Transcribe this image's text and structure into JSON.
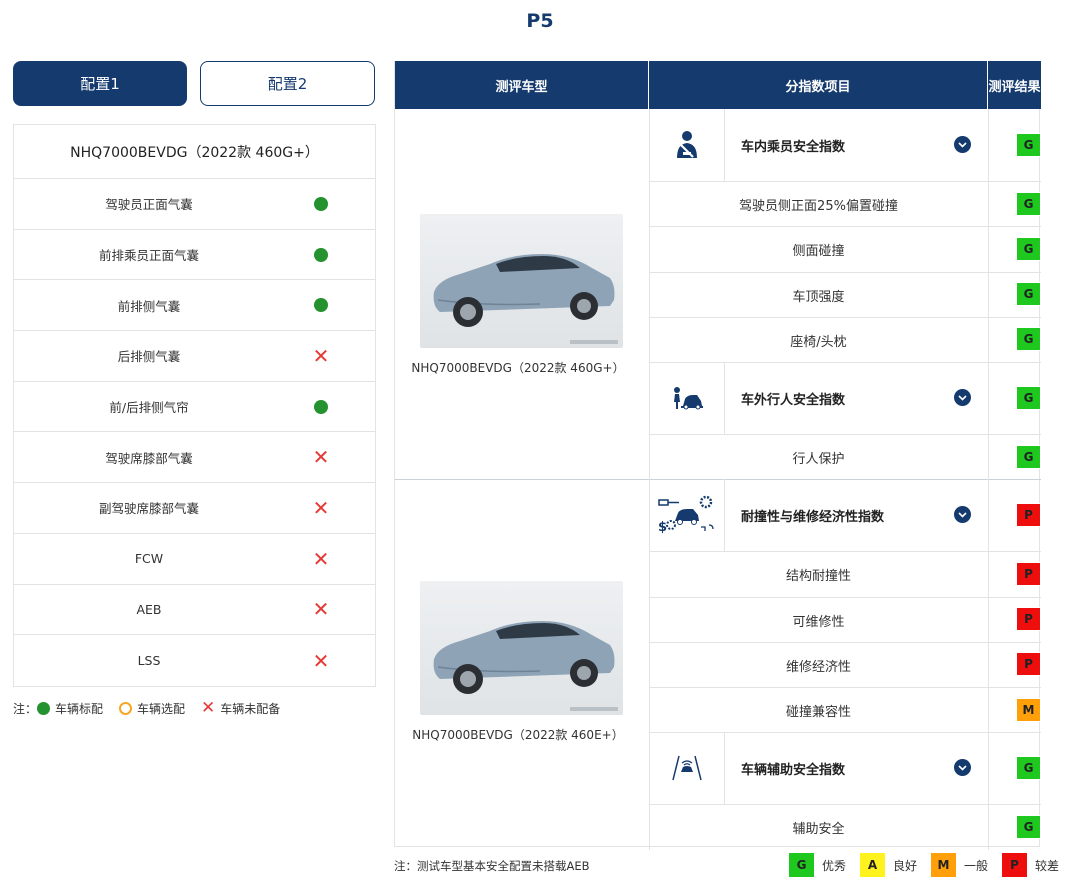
{
  "page": {
    "title": "P5"
  },
  "tabs": [
    {
      "label": "配置1",
      "active": true
    },
    {
      "label": "配置2",
      "active": false
    }
  ],
  "config": {
    "model": "NHQ7000BEVDG（2022款 460G+）",
    "rows": [
      {
        "label": "驾驶员正面气囊",
        "status": "standard"
      },
      {
        "label": "前排乘员正面气囊",
        "status": "standard"
      },
      {
        "label": "前排侧气囊",
        "status": "standard"
      },
      {
        "label": "后排侧气囊",
        "status": "not-equipped"
      },
      {
        "label": "前/后排侧气帘",
        "status": "standard"
      },
      {
        "label": "驾驶席膝部气囊",
        "status": "not-equipped"
      },
      {
        "label": "副驾驶席膝部气囊",
        "status": "not-equipped"
      },
      {
        "label": "FCW",
        "status": "not-equipped"
      },
      {
        "label": "AEB",
        "status": "not-equipped"
      },
      {
        "label": "LSS",
        "status": "not-equipped"
      }
    ]
  },
  "legend_left": {
    "prefix": "注：",
    "standard": "车辆标配",
    "optional": "车辆选配",
    "not_equipped": "车辆未配备"
  },
  "table": {
    "headers": {
      "car": "测评车型",
      "item": "分指数项目",
      "result": "测评结果"
    },
    "cars": [
      {
        "caption": "NHQ7000BEVDG（2022款 460G+）"
      },
      {
        "caption": "NHQ7000BEVDG（2022款 460E+）"
      }
    ],
    "categories": [
      {
        "title": "车内乘员安全指数",
        "icon": "seatbelt-occupant-icon",
        "rating": "G",
        "items": [
          {
            "label": "驾驶员侧正面25%偏置碰撞",
            "rating": "G"
          },
          {
            "label": "侧面碰撞",
            "rating": "G"
          },
          {
            "label": "车顶强度",
            "rating": "G"
          },
          {
            "label": "座椅/头枕",
            "rating": "G"
          }
        ]
      },
      {
        "title": "车外行人安全指数",
        "icon": "pedestrian-car-icon",
        "rating": "G",
        "items": [
          {
            "label": "行人保护",
            "rating": "G"
          }
        ]
      },
      {
        "title": "耐撞性与维修经济性指数",
        "icon": "repair-cost-icon",
        "rating": "P",
        "items": [
          {
            "label": "结构耐撞性",
            "rating": "P"
          },
          {
            "label": "可维修性",
            "rating": "P"
          },
          {
            "label": "维修经济性",
            "rating": "P"
          },
          {
            "label": "碰撞兼容性",
            "rating": "M"
          }
        ]
      },
      {
        "title": "车辆辅助安全指数",
        "icon": "driver-assist-icon",
        "rating": "G",
        "items": [
          {
            "label": "辅助安全",
            "rating": "G"
          }
        ]
      }
    ]
  },
  "note": "注：测试车型基本安全配置未搭载AEB",
  "rating_legend": [
    {
      "code": "G",
      "label": "优秀",
      "color": "#1ec81e"
    },
    {
      "code": "A",
      "label": "良好",
      "color": "#fff21e"
    },
    {
      "code": "M",
      "label": "一般",
      "color": "#ff9f0a"
    },
    {
      "code": "P",
      "label": "较差",
      "color": "#ee0e0e"
    }
  ],
  "colors": {
    "brand": "#143a6e",
    "standard": "#23922f",
    "not_equipped": "#e53935",
    "optional": "#f5a623"
  }
}
